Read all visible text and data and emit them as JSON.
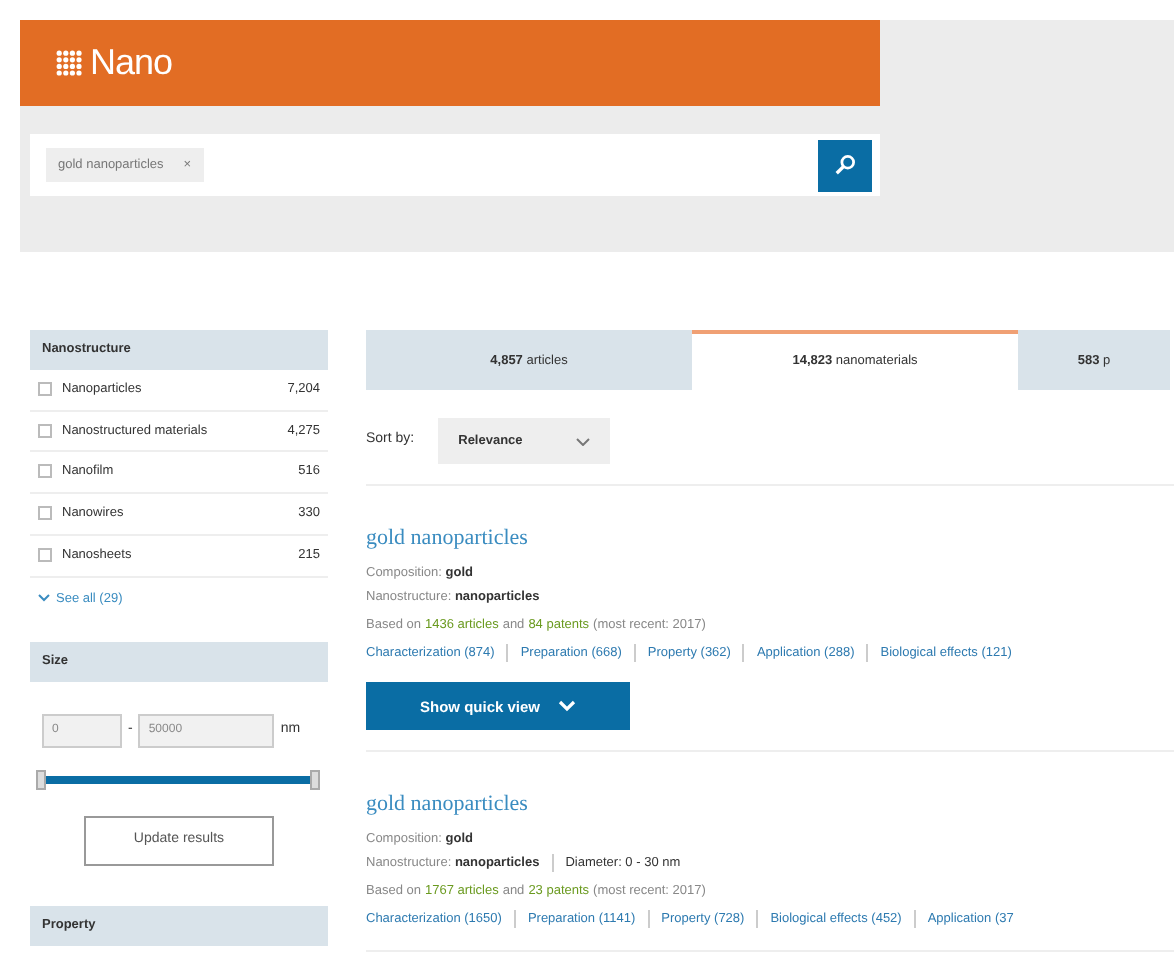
{
  "header": {
    "logo": "Nano"
  },
  "search": {
    "chip": "gold nanoparticles",
    "chip_close": "×"
  },
  "facets": [
    {
      "kind": "checklist",
      "title": "Nanostructure",
      "items": [
        {
          "label": "Nanoparticles",
          "count": "7,204",
          "checked": false
        },
        {
          "label": "Nanostructured materials",
          "count": "4,275",
          "checked": false
        },
        {
          "label": "Nanofilm",
          "count": "516",
          "checked": false
        },
        {
          "label": "Nanowires",
          "count": "330",
          "checked": false
        },
        {
          "label": "Nanosheets",
          "count": "215",
          "checked": false
        }
      ],
      "see_all": "See all (29)"
    },
    {
      "kind": "range",
      "title": "Size",
      "min": "0",
      "dash": "-",
      "max": "50000",
      "unit": "nm",
      "level": 1,
      "button": "Update results"
    },
    {
      "kind": "header",
      "title": "Property"
    }
  ],
  "tabs": [
    {
      "label": "**4,857** articles",
      "selected": false
    },
    {
      "label": "**14,823** nanomaterials",
      "selected": true
    },
    {
      "label": "**583** p",
      "selected": false
    }
  ],
  "sort": {
    "label": "Sort by:",
    "value": "Relevance"
  },
  "results": [
    {
      "title": "gold nanoparticles",
      "composition_label": "Composition:",
      "composition": "gold",
      "nanostructure_label": "Nanostructure:",
      "nanostructure": "nanoparticles",
      "evidence": {
        "prefix": "Based on",
        "articles": "1436 articles",
        "joiner": "and",
        "patents": "84 patents",
        "suffix": "(most recent: 2017)"
      },
      "links": [
        "Characterization (874)",
        "Preparation (668)",
        "Property (362)",
        "Application (288)",
        "Biological effects (121)"
      ],
      "button": "Show quick view"
    },
    {
      "title": "gold nanoparticles",
      "composition_label": "Composition:",
      "composition": "gold",
      "nanostructure_label": "Nanostructure:",
      "nanostructure": "nanoparticles",
      "diameter": "Diameter: 0 - 30 nm",
      "evidence": {
        "prefix": "Based on",
        "articles": "1767 articles",
        "joiner": "and",
        "patents": "23 patents",
        "suffix": "(most recent: 2017)"
      },
      "links": [
        "Characterization (1650)",
        "Preparation (1141)",
        "Property (728)",
        "Biological effects (452)",
        "Application (37"
      ]
    }
  ]
}
